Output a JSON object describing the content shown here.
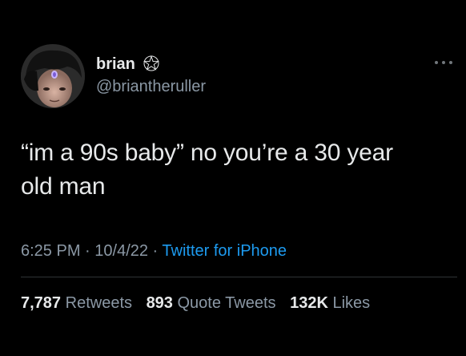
{
  "author": {
    "name": "brian",
    "handle": "@briantheruller",
    "badge_icon": "pentagram-icon",
    "avatar_icon": "profile-photo"
  },
  "tweet": {
    "text_line1": "“im a 90s baby” no you’re a 30 year",
    "text_line2": "old man"
  },
  "meta": {
    "time": "6:25 PM",
    "sep1": " · ",
    "date": "10/4/22",
    "sep2": " · ",
    "source": "Twitter for iPhone"
  },
  "stats": {
    "retweets_count": "7,787",
    "retweets_label": "Retweets",
    "quotes_count": "893",
    "quotes_label": "Quote Tweets",
    "likes_count": "132K",
    "likes_label": "Likes"
  },
  "colors": {
    "background": "#000000",
    "text": "#e7e9ea",
    "muted": "#8b98a5",
    "link": "#1d9bf0",
    "divider": "#2f3336"
  },
  "menu_icon": "more-horizontal-icon"
}
